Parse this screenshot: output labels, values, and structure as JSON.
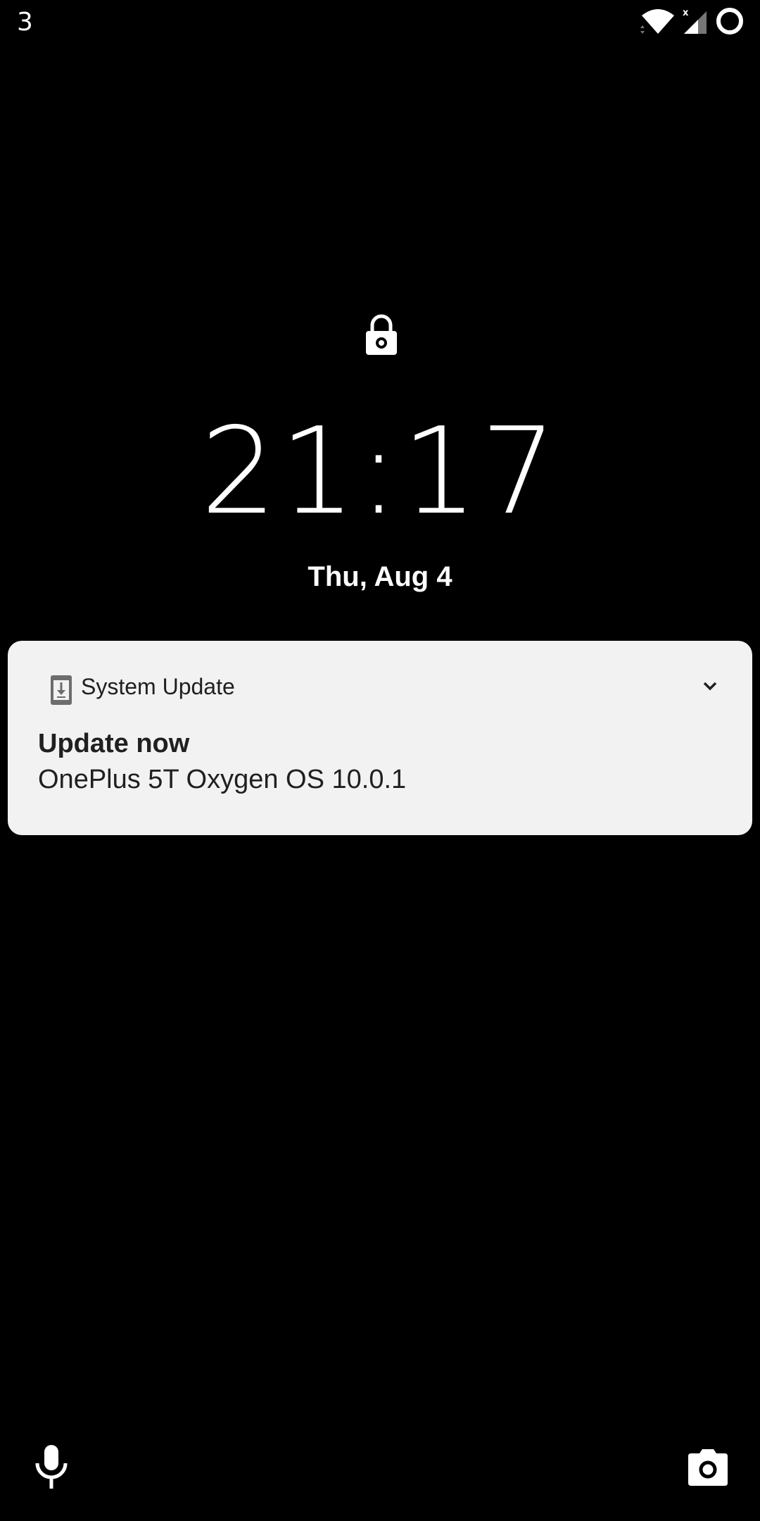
{
  "status_bar": {
    "notification_count": "3",
    "icons": [
      "wifi-icon",
      "signal-icon",
      "battery-icon"
    ]
  },
  "lock_screen": {
    "lock_icon": "lock-icon",
    "time": "21:17",
    "date": "Thu, Aug 4"
  },
  "notification": {
    "app_icon": "system-update-icon",
    "app_name": "System Update",
    "title": "Update now",
    "text": "OnePlus 5T Oxygen OS 10.0.1",
    "expand_icon": "chevron-down-icon"
  },
  "shortcuts": {
    "left_icon": "microphone-icon",
    "right_icon": "camera-icon"
  },
  "colors": {
    "background": "#000000",
    "notification_bg": "#f2f2f2",
    "text_dark": "#202020",
    "text_light": "#ffffff"
  }
}
